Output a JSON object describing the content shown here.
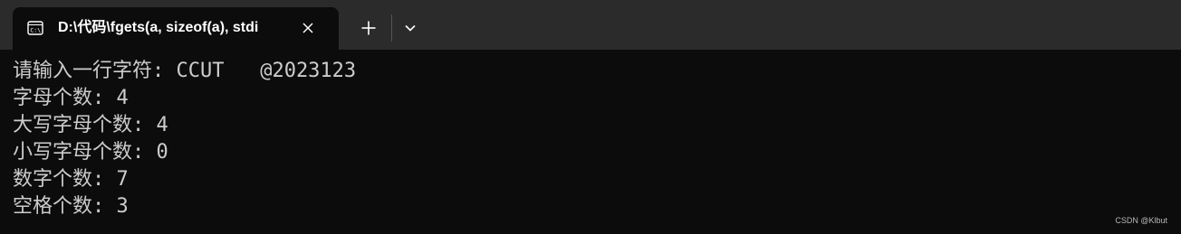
{
  "window": {
    "tab_title": "D:\\代码\\fgets(a, sizeof(a), stdi",
    "tab_icon": "cmd-icon",
    "close_icon": "close-icon",
    "new_tab_icon": "plus-icon",
    "dropdown_icon": "chevron-down-icon"
  },
  "terminal": {
    "lines": [
      "请输入一行字符: CCUT   @2023123",
      "字母个数: 4",
      "大写字母个数: 4",
      "小写字母个数: 0",
      "数字个数: 7",
      "空格个数: 3"
    ]
  },
  "watermark": "CSDN @Klbut",
  "colors": {
    "titlebar": "#2b2b2b",
    "background": "#0c0c0c",
    "text": "#cccccc"
  }
}
